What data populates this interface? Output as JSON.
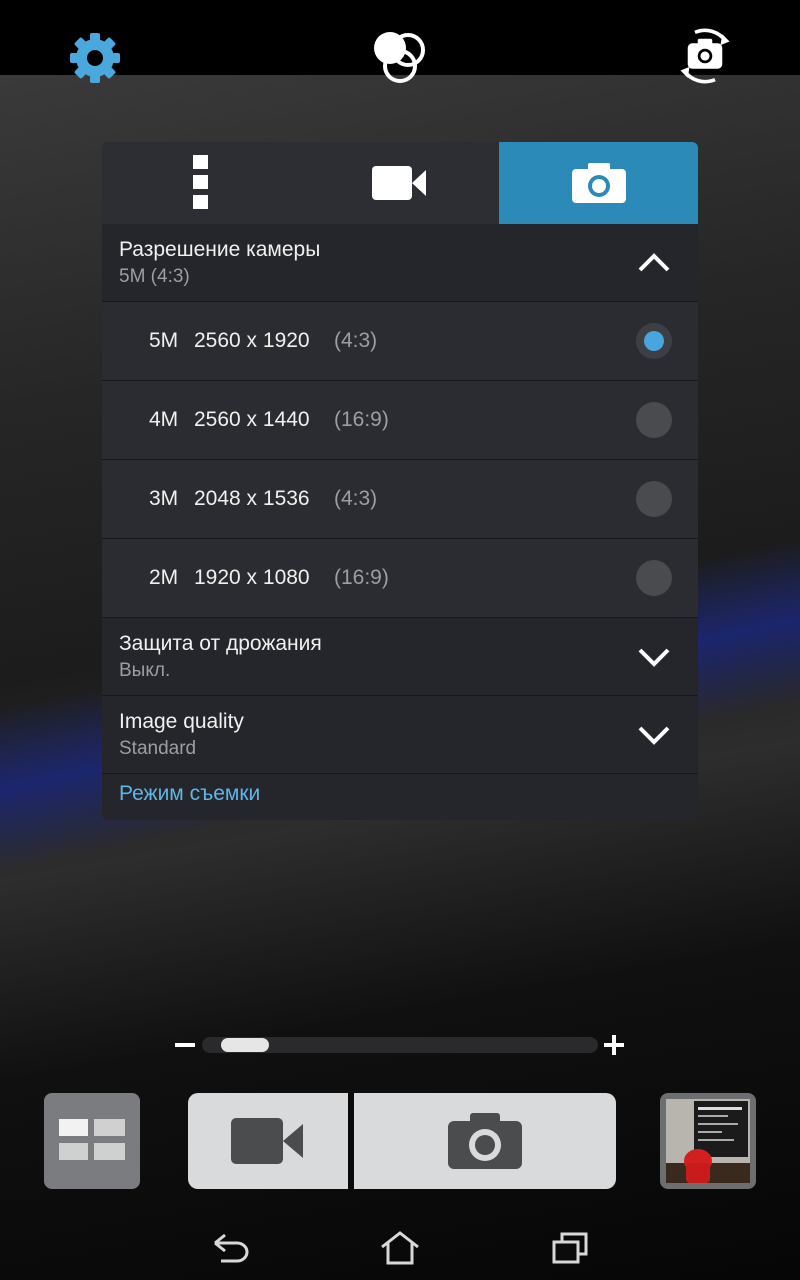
{
  "colors": {
    "accent": "#2b8ab8",
    "link": "#5fb5e6",
    "radio_selected": "#46a6dd"
  },
  "topbar": {
    "icons": [
      "gear-icon",
      "color-effects-icon",
      "switch-camera-icon"
    ]
  },
  "panel": {
    "tabs": [
      {
        "icon": "more-vertical-icon",
        "active": false
      },
      {
        "icon": "video-camera-icon",
        "active": false
      },
      {
        "icon": "camera-icon",
        "active": true
      }
    ],
    "resolution": {
      "title": "Разрешение камеры",
      "value": "5M (4:3)",
      "expanded": true,
      "options": [
        {
          "mp": "5M",
          "dims": "2560 x 1920",
          "ratio": "(4:3)",
          "selected": true
        },
        {
          "mp": "4M",
          "dims": "2560 x 1440",
          "ratio": "(16:9)",
          "selected": false
        },
        {
          "mp": "3M",
          "dims": "2048 x 1536",
          "ratio": "(4:3)",
          "selected": false
        },
        {
          "mp": "2M",
          "dims": "1920 x 1080",
          "ratio": "(16:9)",
          "selected": false
        }
      ]
    },
    "stabilization": {
      "title": "Защита от дрожания",
      "value": "Выкл."
    },
    "quality": {
      "title": "Image quality",
      "value": "Standard"
    },
    "mode_link": "Режим съемки"
  },
  "zoom": {
    "level": 0.05
  },
  "bottom": {
    "icons": [
      "mode-grid-icon",
      "video-record-icon",
      "shutter-camera-icon",
      "gallery-thumbnail"
    ]
  },
  "navbar": {
    "icons": [
      "back-icon",
      "home-icon",
      "recent-apps-icon"
    ]
  }
}
